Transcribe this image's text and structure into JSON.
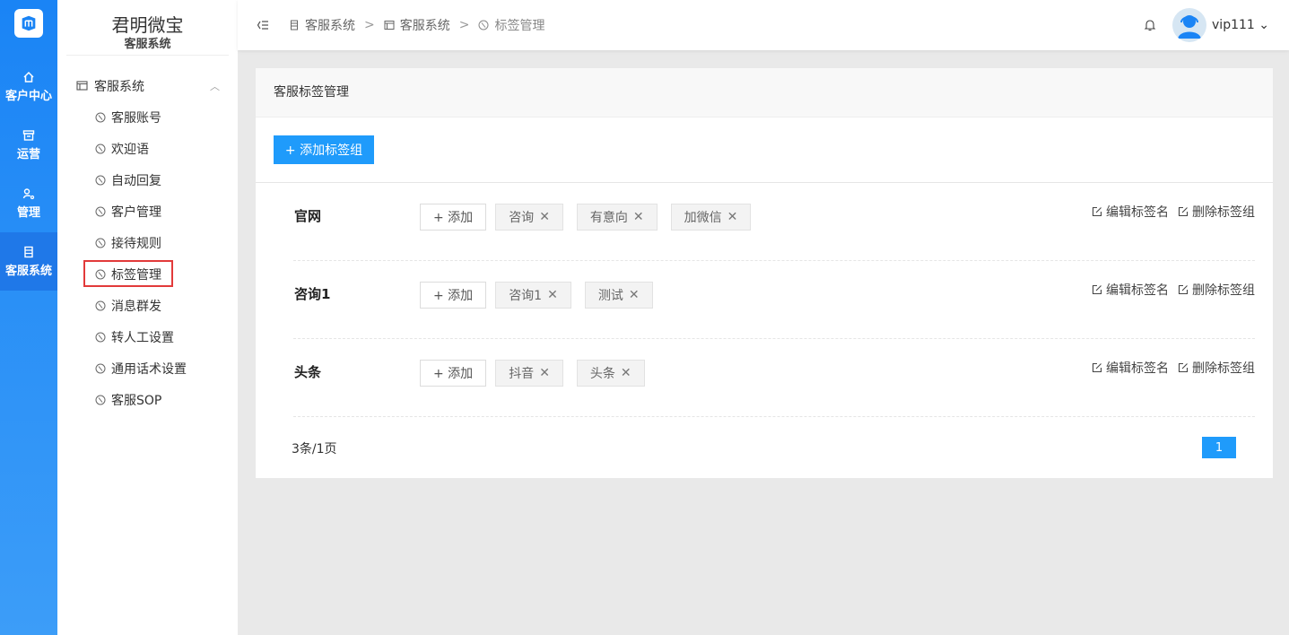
{
  "rail": {
    "items": [
      {
        "label": "客户中心",
        "icon": "home-icon"
      },
      {
        "label": "运营",
        "icon": "archive-icon"
      },
      {
        "label": "管理",
        "icon": "user-key-icon"
      },
      {
        "label": "客服系统",
        "icon": "bookmark-icon"
      }
    ],
    "active_color": "#1f78e8"
  },
  "sidebar": {
    "brand_title": "君明微宝",
    "brand_sub": "客服系统",
    "group_label": "客服系统",
    "items": [
      {
        "label": "客服账号"
      },
      {
        "label": "欢迎语"
      },
      {
        "label": "自动回复"
      },
      {
        "label": "客户管理"
      },
      {
        "label": "接待规则"
      },
      {
        "label": "标签管理"
      },
      {
        "label": "消息群发"
      },
      {
        "label": "转人工设置"
      },
      {
        "label": "通用话术设置"
      },
      {
        "label": "客服SOP"
      }
    ]
  },
  "header": {
    "breadcrumb": [
      "客服系统",
      "客服系统",
      "标签管理"
    ],
    "separator": ">",
    "user_name": "vip111"
  },
  "main": {
    "title": "客服标签管理",
    "add_group_label": "+ 添加标签组",
    "add_tag_label": "+ 添加",
    "edit_label": "编辑标签名",
    "delete_label": "删除标签组",
    "groups": [
      {
        "name": "官网",
        "tags": [
          "咨询",
          "有意向",
          "加微信"
        ]
      },
      {
        "name": "咨询1",
        "tags": [
          "咨询1",
          "测试"
        ]
      },
      {
        "name": "头条",
        "tags": [
          "抖音",
          "头条"
        ]
      }
    ],
    "pagination": {
      "summary": "3条/1页",
      "current_page": "1"
    },
    "accent_color": "#1f9bfb"
  }
}
